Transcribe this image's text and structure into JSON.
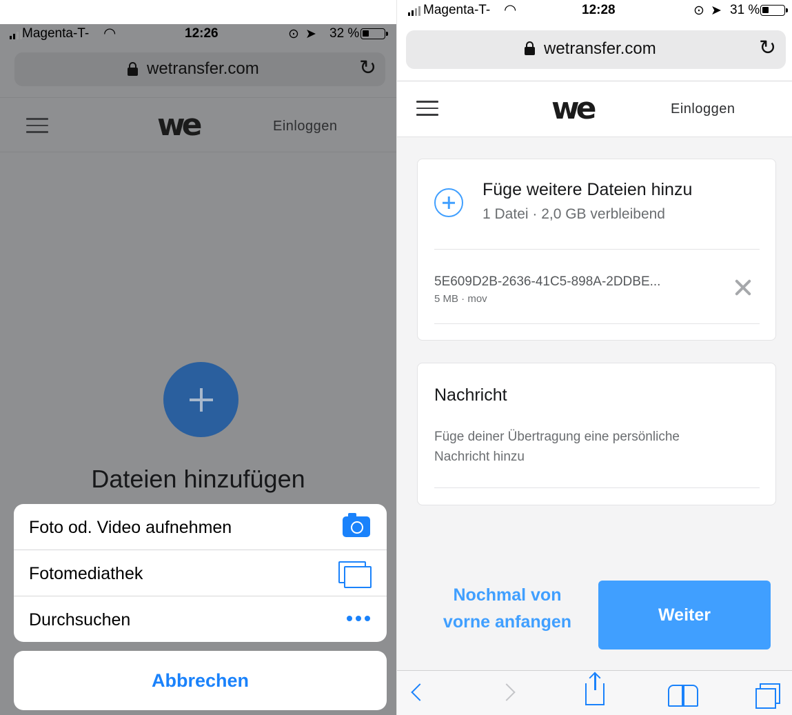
{
  "left": {
    "status": {
      "carrier": "Magenta-T-",
      "time": "12:26",
      "battery": "32 %",
      "battery_level": 0.32
    },
    "url": "wetransfer.com",
    "nav": {
      "logo": "we",
      "login": "Einloggen"
    },
    "main": {
      "title": "Dateien hinzufügen"
    },
    "action_sheet": {
      "items": [
        {
          "label": "Foto od. Video aufnehmen",
          "icon": "camera-icon"
        },
        {
          "label": "Fotomediathek",
          "icon": "photo-library-icon"
        },
        {
          "label": "Durchsuchen",
          "icon": "more-dots-icon"
        }
      ],
      "cancel": "Abbrechen"
    }
  },
  "right": {
    "status": {
      "carrier": "Magenta-T-",
      "time": "12:28",
      "battery": "31 %",
      "battery_level": 0.31
    },
    "url": "wetransfer.com",
    "nav": {
      "logo": "we",
      "login": "Einloggen"
    },
    "files_card": {
      "title": "Füge weitere Dateien hinzu",
      "subtitle": "1 Datei · 2,0 GB verbleibend",
      "file": {
        "name": "5E609D2B-2636-41C5-898A-2DDBE...",
        "meta": "5 MB · mov"
      }
    },
    "message_card": {
      "title": "Nachricht",
      "placeholder": "Füge deiner Übertragung eine persönliche Nachricht hinzu"
    },
    "actions": {
      "restart": "Nochmal von vorne anfangen",
      "next": "Weiter"
    },
    "toolbar": [
      "back-icon",
      "forward-icon",
      "share-icon",
      "bookmarks-icon",
      "tabs-icon"
    ],
    "colors": {
      "accent": "#409fff",
      "ios_blue": "#1a82fb"
    }
  }
}
